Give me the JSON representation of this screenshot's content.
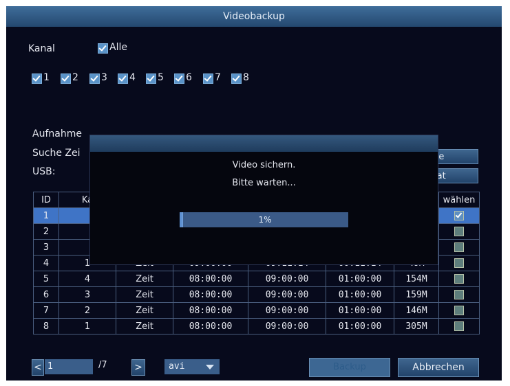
{
  "window": {
    "title": "Videobackup"
  },
  "channel": {
    "label": "Kanal",
    "all": {
      "label": "Alle",
      "checked": true
    },
    "items": [
      {
        "label": "1",
        "checked": true
      },
      {
        "label": "2",
        "checked": true
      },
      {
        "label": "3",
        "checked": true
      },
      {
        "label": "4",
        "checked": true
      },
      {
        "label": "5",
        "checked": true
      },
      {
        "label": "6",
        "checked": true
      },
      {
        "label": "7",
        "checked": true
      },
      {
        "label": "8",
        "checked": true
      }
    ]
  },
  "record": {
    "label": "Aufnahme"
  },
  "search": {
    "label": "Suche Zei",
    "button_label": "che"
  },
  "usb": {
    "label": "USB:",
    "format_button_label": "mat"
  },
  "table": {
    "headers": {
      "id": "ID",
      "channel": "Ka",
      "select": "wählen"
    },
    "rows": [
      {
        "id": "1",
        "channel": "",
        "type": "",
        "start": "",
        "end": "",
        "length": "",
        "size": "",
        "selected": true
      },
      {
        "id": "2",
        "channel": "",
        "type": "",
        "start": "",
        "end": "",
        "length": "",
        "size": "",
        "selected": false
      },
      {
        "id": "3",
        "channel": "",
        "type": "",
        "start": "",
        "end": "",
        "length": "",
        "size": "",
        "selected": false
      },
      {
        "id": "4",
        "channel": "1",
        "type": "Zeit",
        "start": "09:00:00",
        "end": "09:11:14",
        "length": "00:11:14",
        "size": "49M",
        "selected": false
      },
      {
        "id": "5",
        "channel": "4",
        "type": "Zeit",
        "start": "08:00:00",
        "end": "09:00:00",
        "length": "01:00:00",
        "size": "154M",
        "selected": false
      },
      {
        "id": "6",
        "channel": "3",
        "type": "Zeit",
        "start": "08:00:00",
        "end": "09:00:00",
        "length": "01:00:00",
        "size": "159M",
        "selected": false
      },
      {
        "id": "7",
        "channel": "2",
        "type": "Zeit",
        "start": "08:00:00",
        "end": "09:00:00",
        "length": "01:00:00",
        "size": "146M",
        "selected": false
      },
      {
        "id": "8",
        "channel": "1",
        "type": "Zeit",
        "start": "08:00:00",
        "end": "09:00:00",
        "length": "01:00:00",
        "size": "305M",
        "selected": false
      }
    ]
  },
  "pagination": {
    "prev_icon": "chevron-left-icon",
    "page_value": "1",
    "total": "/7",
    "next_icon": "chevron-right-icon"
  },
  "format": {
    "value": "avi",
    "dropdown_icon": "chevron-down-icon"
  },
  "buttons": {
    "backup_label": "Backup",
    "cancel_label": "Abbrechen"
  },
  "dialog": {
    "line1": "Video sichern.",
    "line2": "Bitte warten...",
    "progress_text": "1%",
    "progress": 0.01
  },
  "colors": {
    "background": "#070a1c",
    "titlebar": "#2f5880",
    "selected_row": "#3f74c6",
    "accent": "#5a93c8"
  }
}
